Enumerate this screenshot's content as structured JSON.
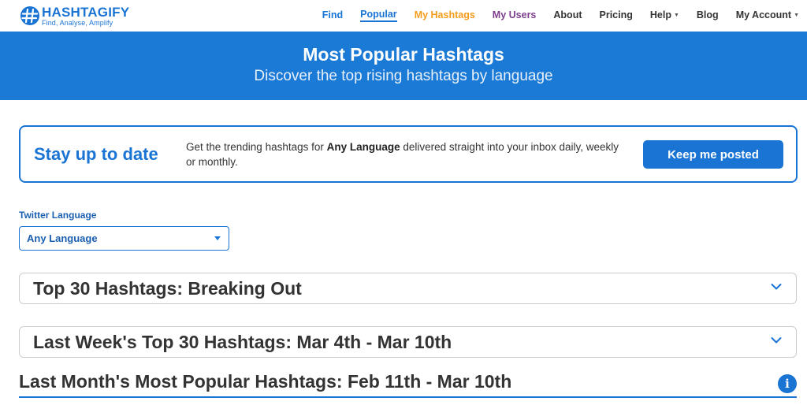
{
  "brand": {
    "name": "HASHTAGIFY",
    "tagline": "Find, Analyse, Amplify",
    "color": "#1a74d4"
  },
  "nav": {
    "items": [
      {
        "label": "Find"
      },
      {
        "label": "Popular"
      },
      {
        "label": "My Hashtags"
      },
      {
        "label": "My Users"
      },
      {
        "label": "About"
      },
      {
        "label": "Pricing"
      },
      {
        "label": "Help"
      },
      {
        "label": "Blog"
      },
      {
        "label": "My Account"
      }
    ],
    "active": "Popular"
  },
  "hero": {
    "title": "Most Popular Hashtags",
    "subtitle": "Discover the top rising hashtags by language",
    "background": "#1b7ad6"
  },
  "stay": {
    "title": "Stay up to date",
    "text_before": "Get the trending hashtags for ",
    "text_bold": "Any Language",
    "text_after": " delivered straight into your inbox daily, weekly or monthly.",
    "button_label": "Keep me posted"
  },
  "language": {
    "label": "Twitter Language",
    "selected": "Any Language"
  },
  "sections": {
    "breaking_out": "Top 30 Hashtags: Breaking Out",
    "last_week": "Last Week's Top 30 Hashtags: Mar 4th - Mar 10th",
    "last_month": "Last Month's Most Popular Hashtags: Feb 11th - Mar 10th"
  },
  "icons": {
    "logo": "hashtag-globe-icon",
    "chevron": "chevron-down-icon",
    "info": "info-icon"
  }
}
